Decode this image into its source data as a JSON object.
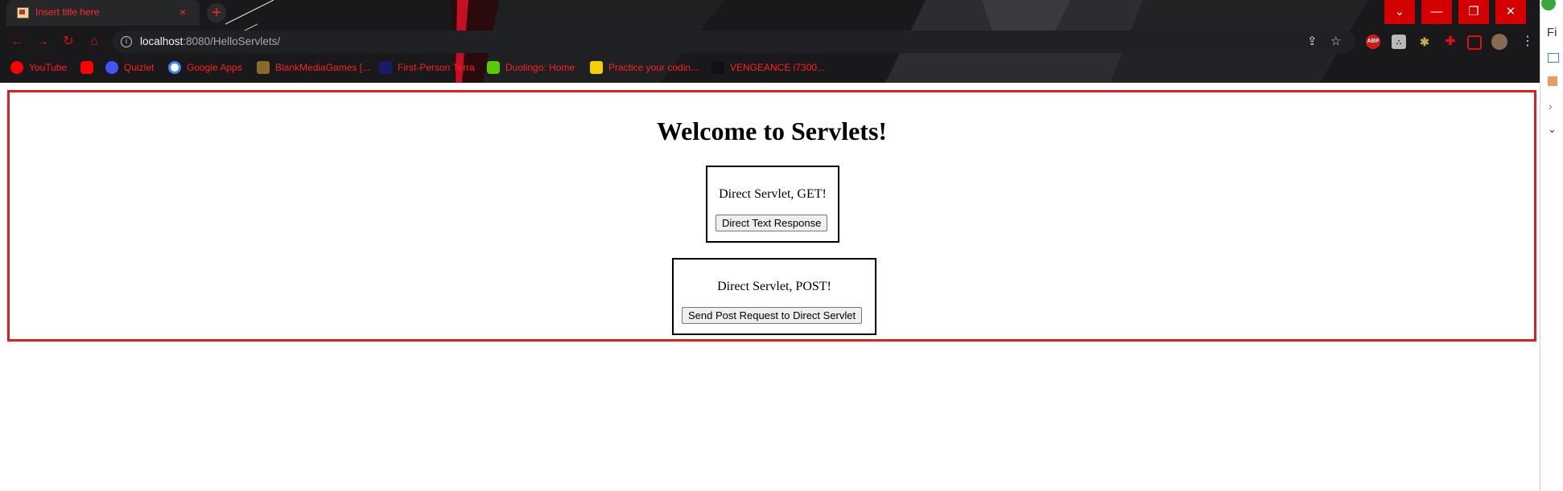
{
  "tab": {
    "title": "Insert title here",
    "close": "×"
  },
  "new_tab": "+",
  "window_controls": {
    "dropdown": "⌄",
    "minimize": "—",
    "restore": "❐",
    "close": "✕"
  },
  "address_bar": {
    "host": "localhost",
    "rest": ":8080/HelloServlets/"
  },
  "nav_icons": {
    "back": "←",
    "forward": "→",
    "reload": "↻",
    "home": "⌂"
  },
  "extensions": {
    "adblock": "ABP"
  },
  "bookmarks": [
    {
      "label": "YouTube",
      "icon": "youtube-icon"
    },
    {
      "label": "",
      "icon": "youtube-icon"
    },
    {
      "label": "Quizlet",
      "icon": "quizlet-icon"
    },
    {
      "label": "Google Apps",
      "icon": "google-icon"
    },
    {
      "label": "BlankMediaGames [...",
      "icon": "blankmediagames-icon"
    },
    {
      "label": "First-Person Terra",
      "icon": "first-person-terra-icon"
    },
    {
      "label": "Duolingo: Home",
      "icon": "duolingo-icon"
    },
    {
      "label": "Practice your codin...",
      "icon": "codewars-icon"
    },
    {
      "label": "VENGEANCE i7300...",
      "icon": "corsair-icon"
    }
  ],
  "side_panel": {
    "label": "Fi"
  },
  "page": {
    "heading": "Welcome to Servlets!",
    "get_form": {
      "text": "Direct Servlet, GET!",
      "button": "Direct Text Response"
    },
    "post_form": {
      "text": "Direct Servlet, POST!",
      "button": "Send Post Request to Direct Servlet"
    }
  },
  "colors": {
    "accent": "#ff2020",
    "window_controls": "#d40000",
    "highlight_border": "#e02020"
  }
}
